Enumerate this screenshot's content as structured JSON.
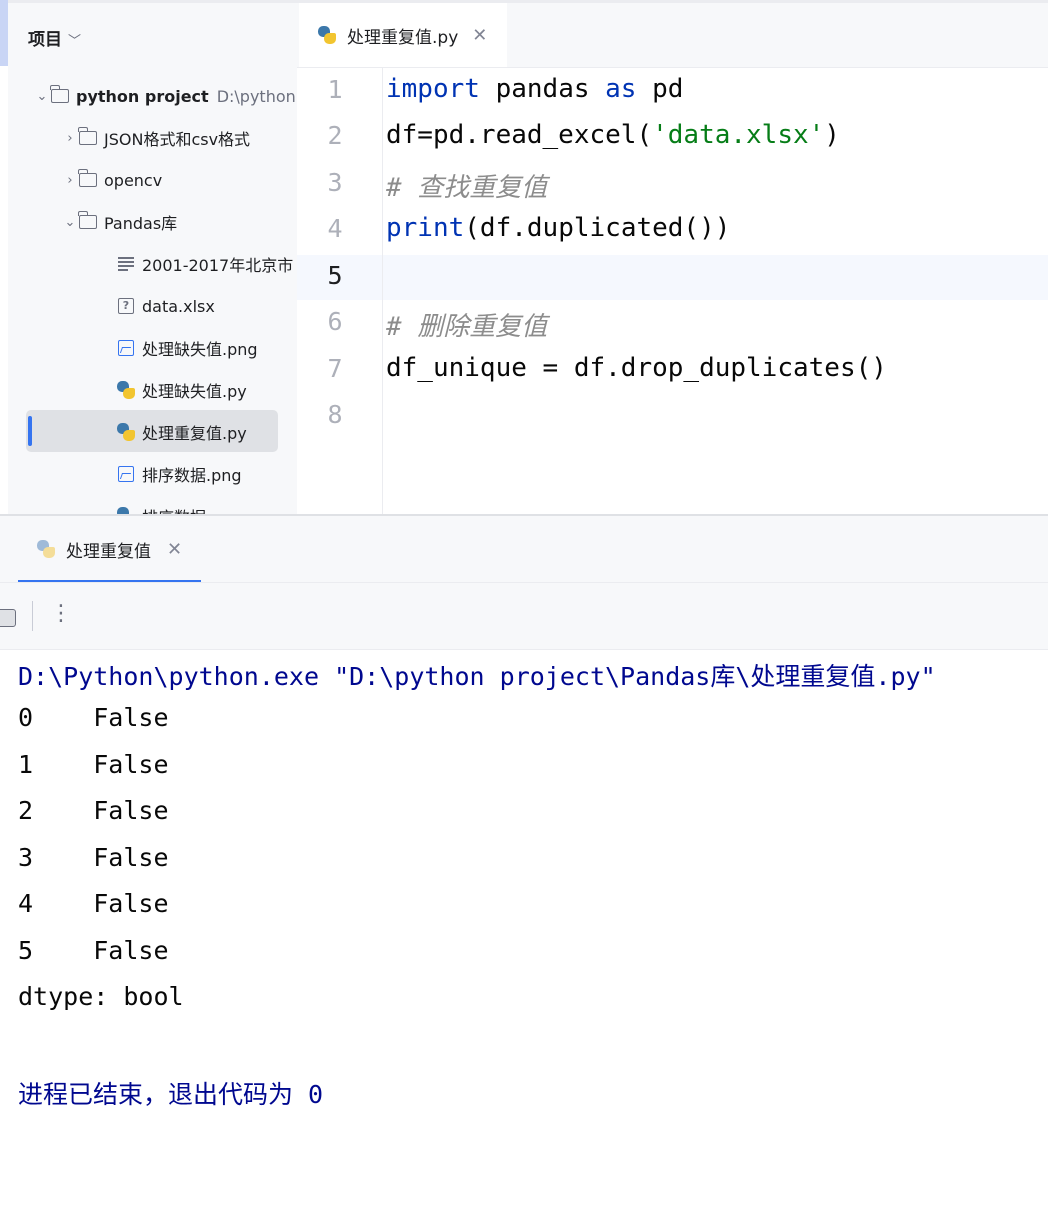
{
  "project_panel": {
    "title": "项目",
    "root": {
      "name": "python project",
      "path_hint": "D:\\python"
    },
    "items": [
      {
        "label": "JSON格式和csv格式",
        "kind": "folder"
      },
      {
        "label": "opencv",
        "kind": "folder"
      },
      {
        "label": "Pandas库",
        "kind": "folder"
      },
      {
        "label": "2001-2017年北京市",
        "kind": "text-file"
      },
      {
        "label": "data.xlsx",
        "kind": "unknown-file"
      },
      {
        "label": "处理缺失值.png",
        "kind": "image-file"
      },
      {
        "label": "处理缺失值.py",
        "kind": "python-file"
      },
      {
        "label": "处理重复值.py",
        "kind": "python-file",
        "selected": true
      },
      {
        "label": "排序数据.png",
        "kind": "image-file"
      },
      {
        "label": "排序数据.py",
        "kind": "python-file"
      }
    ]
  },
  "editor": {
    "tab_label": "处理重复值.py",
    "current_line": 5,
    "line_numbers": [
      "1",
      "2",
      "3",
      "4",
      "5",
      "6",
      "7",
      "8"
    ],
    "code": {
      "l1": {
        "kw1": "import",
        "t1": " pandas ",
        "kw2": "as",
        "t2": " pd"
      },
      "l2": {
        "t1": "df=pd.read_excel(",
        "str": "'data.xlsx'",
        "t2": ")"
      },
      "l3": {
        "comment": "# 查找重复值"
      },
      "l4": {
        "kw": "print",
        "t1": "(df.duplicated())"
      },
      "l6": {
        "comment": "# 删除重复值"
      },
      "l7": {
        "t1": "df_unique = df.drop_duplicates()"
      }
    }
  },
  "run_panel": {
    "tab_label": "处理重复值",
    "command": "D:\\Python\\python.exe \"D:\\python project\\Pandas库\\处理重复值.py\"",
    "output_lines": [
      "0    False",
      "1    False",
      "2    False",
      "3    False",
      "4    False",
      "5    False",
      "dtype: bool"
    ],
    "exit_message": "进程已结束，退出代码为 0"
  },
  "colors": {
    "keyword": "#0033b3",
    "string": "#067d17",
    "comment": "#8c8c8c",
    "accent": "#3574f0",
    "console_blue": "#00088f"
  }
}
